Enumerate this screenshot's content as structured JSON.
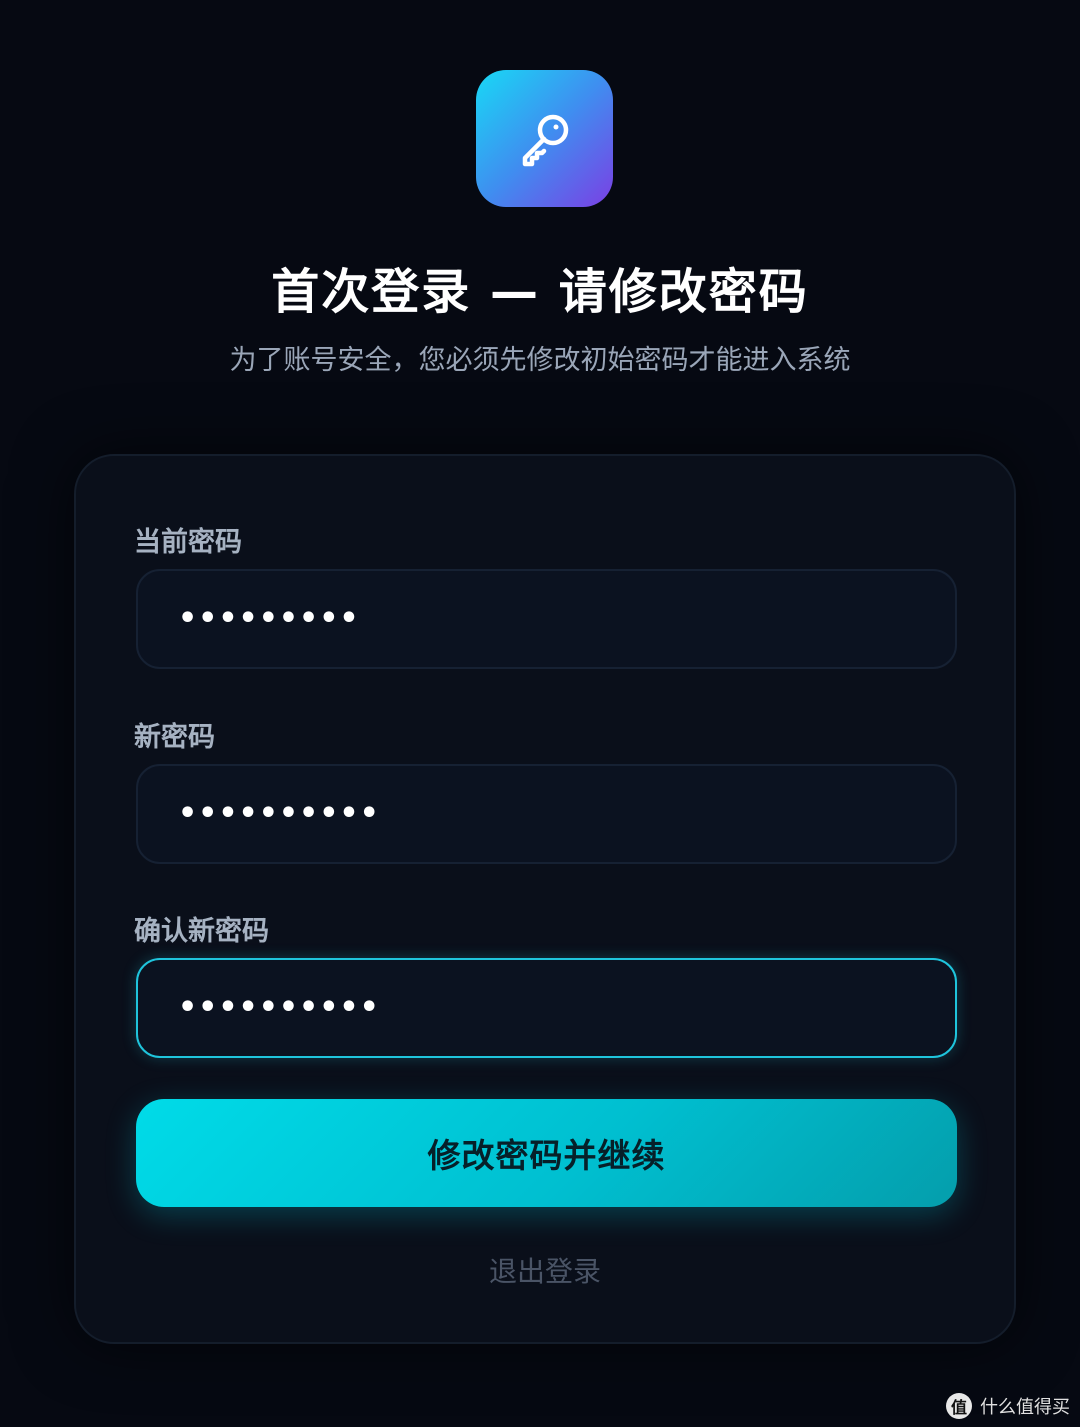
{
  "header": {
    "logo_icon": "key-icon",
    "title": "首次登录 — 请修改密码",
    "subtitle": "为了账号安全，您必须先修改初始密码才能进入系统"
  },
  "form": {
    "fields": [
      {
        "label": "当前密码",
        "value": "•••••••••",
        "focused": false
      },
      {
        "label": "新密码",
        "value": "••••••••••",
        "focused": false
      },
      {
        "label": "确认新密码",
        "value": "••••••••••",
        "focused": true
      }
    ],
    "submit_label": "修改密码并继续",
    "logout_label": "退出登录"
  },
  "watermark": {
    "badge": "值",
    "text": "什么值得买"
  },
  "colors": {
    "background": "#060912",
    "card": "#0a0f1a",
    "accent": "#00d2e6",
    "logo_gradient_start": "#18d9f5",
    "logo_gradient_end": "#7b3fe4"
  }
}
